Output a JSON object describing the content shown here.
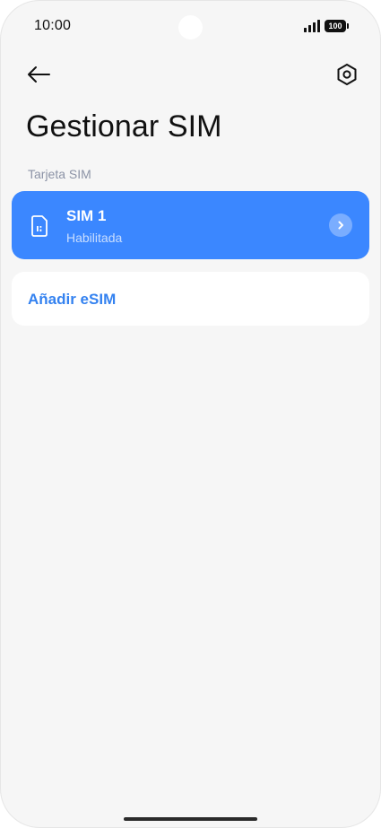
{
  "status_bar": {
    "time": "10:00",
    "battery": "100",
    "icons": [
      "signal-icon",
      "battery-icon"
    ]
  },
  "header": {
    "back_icon": "arrow-left-icon",
    "settings_icon": "hexagon-settings-icon",
    "title": "Gestionar SIM"
  },
  "section": {
    "label": "Tarjeta SIM"
  },
  "sim_card": {
    "name": "SIM 1",
    "status": "Habilitada",
    "icon": "sim-card-icon",
    "chevron_icon": "chevron-right-icon",
    "background_color": "#3b87ff"
  },
  "add_esim": {
    "label": "Añadir eSIM",
    "color": "#3482f0"
  },
  "colors": {
    "background": "#f6f6f6",
    "accent": "#3b87ff",
    "card": "#ffffff"
  }
}
